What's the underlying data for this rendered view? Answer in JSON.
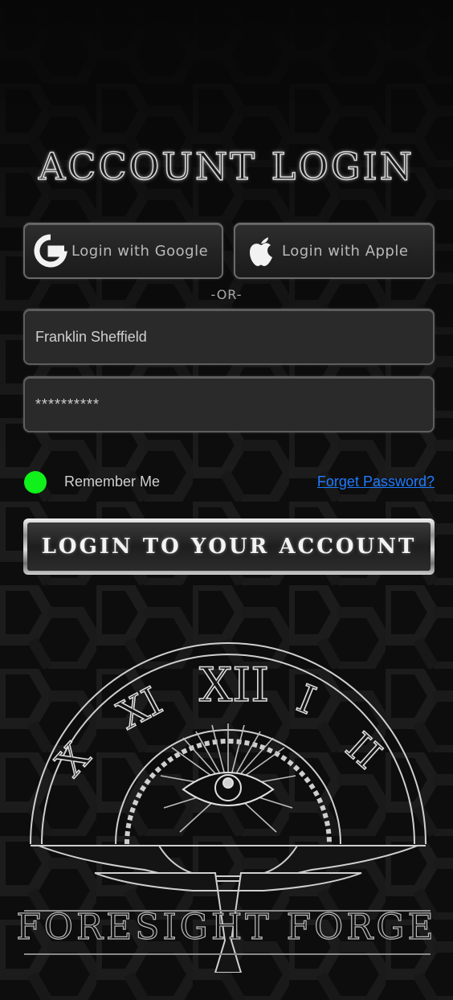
{
  "header": {
    "title": "ACCOUNT LOGIN"
  },
  "social": {
    "google_label": "Login with Google",
    "apple_label": "Login with Apple",
    "google_icon": "google-g-icon",
    "apple_icon": "apple-logo-icon"
  },
  "divider": {
    "text": "-OR-"
  },
  "form": {
    "username_value": "Franklin Sheffield",
    "password_value": "**********",
    "remember_label": "Remember Me",
    "remember_color": "#10f01a",
    "forget_label": "Forget Password?",
    "forget_color": "#1f7bff"
  },
  "login_button": {
    "label": "LOGIN TO YOUR ACCOUNT"
  },
  "brand": {
    "name": "FORESIGHT FORGE",
    "numerals": [
      "X",
      "XI",
      "XII",
      "I",
      "II"
    ],
    "emblem_icon": "clock-eye-anvil-emblem"
  }
}
